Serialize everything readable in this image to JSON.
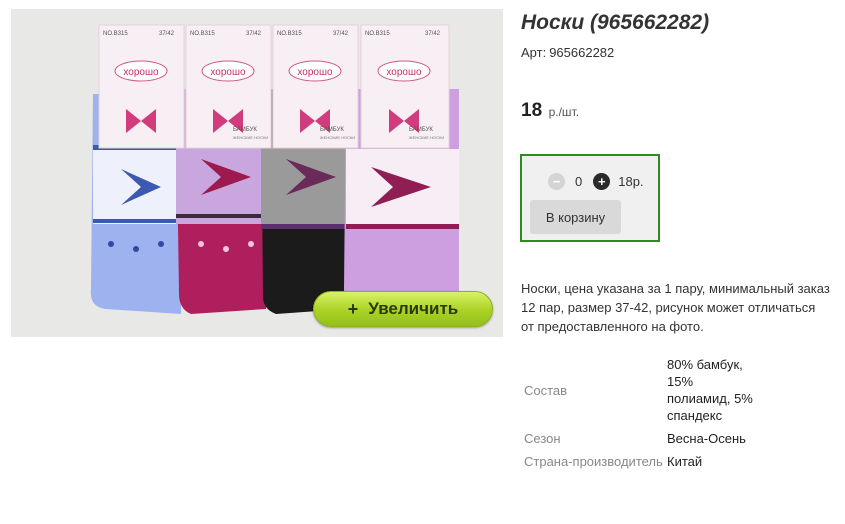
{
  "product": {
    "title": "Носки (965662282)",
    "sku_label": "Арт:",
    "sku": "965662282",
    "price": "18",
    "price_unit": "р./шт."
  },
  "image": {
    "zoom_label": "Увеличить",
    "zoom_icon": "plus-icon",
    "packaging": {
      "brand": "хорошо",
      "model": "NO.B315",
      "size": "37/42",
      "material": "БАМБУК",
      "sub": "ЖЕНСКИЕ НОСКИ"
    },
    "sock_colors": [
      "#8fa8e6",
      "#c2a0d8",
      "#5c5c5c",
      "#c99de0"
    ]
  },
  "buy": {
    "quantity": "0",
    "total": "18р.",
    "minus_icon": "minus-icon",
    "plus_icon": "plus-icon",
    "cart_label": "В корзину",
    "accent_color": "#2e8b1f"
  },
  "description": "Носки, цена указана за 1 пару, минимальный заказ 12 пар, размер 37-42, рисунок может отличаться от предоставленного на фото.",
  "specs": [
    {
      "name": "Состав",
      "value": "80% бамбук, 15% полиамид, 5% спандекс"
    },
    {
      "name": "Сезон",
      "value": "Весна-Осень"
    },
    {
      "name": "Страна-производитель",
      "value": "Китай"
    }
  ]
}
